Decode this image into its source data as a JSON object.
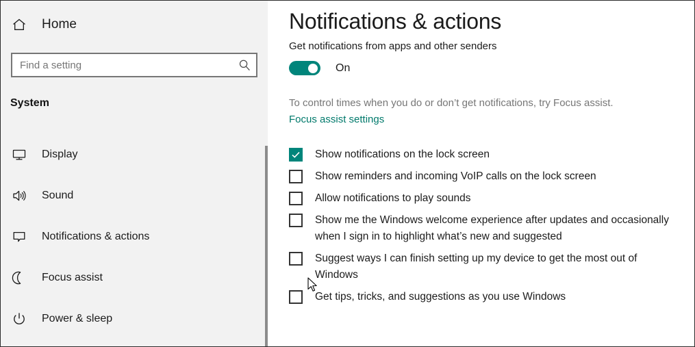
{
  "sidebar": {
    "home": {
      "label": "Home",
      "icon": "home-icon"
    },
    "search": {
      "placeholder": "Find a setting",
      "value": "",
      "icon": "search-icon"
    },
    "group_label": "System",
    "items": [
      {
        "label": "Display",
        "icon": "monitor-icon"
      },
      {
        "label": "Sound",
        "icon": "speaker-icon"
      },
      {
        "label": "Notifications & actions",
        "icon": "speech-bubble-icon"
      },
      {
        "label": "Focus assist",
        "icon": "moon-icon"
      },
      {
        "label": "Power & sleep",
        "icon": "power-icon"
      }
    ]
  },
  "content": {
    "title": "Notifications & actions",
    "section_subtitle": "Get notifications from apps and other senders",
    "toggle": {
      "state_label": "On",
      "checked": true
    },
    "hint_text": "To control times when you do or don’t get notifications, try Focus assist.",
    "link_label": "Focus assist settings",
    "checkboxes": [
      {
        "label": "Show notifications on the lock screen",
        "checked": true
      },
      {
        "label": "Show reminders and incoming VoIP calls on the lock screen",
        "checked": false
      },
      {
        "label": "Allow notifications to play sounds",
        "checked": false
      },
      {
        "label": "Show me the Windows welcome experience after updates and occasionally when I sign in to highlight what’s new and suggested",
        "checked": false
      },
      {
        "label": "Suggest ways I can finish setting up my device to get the most out of Windows",
        "checked": false
      },
      {
        "label": "Get tips, tricks, and suggestions as you use Windows",
        "checked": false
      }
    ]
  },
  "colors": {
    "accent_teal": "#00857b",
    "link_teal": "#00796b",
    "sidebar_bg": "#f2f2f2",
    "content_bg": "#ffffff",
    "text": "#1b1b1b",
    "muted_text": "#767676"
  }
}
